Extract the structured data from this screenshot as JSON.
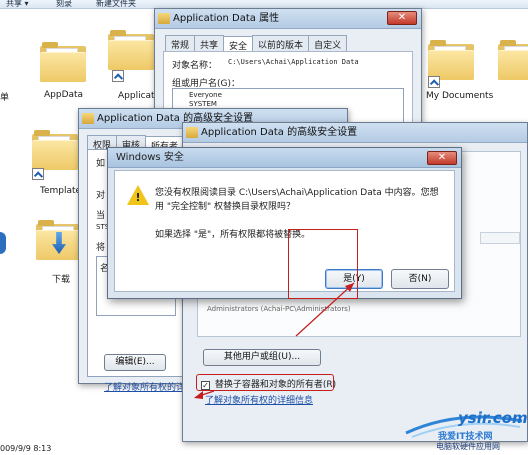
{
  "toolbar": {
    "items": [
      "共享 ▾",
      "刻录",
      "新建文件夹"
    ]
  },
  "desktop": {
    "labels": {
      "left_cut": "单",
      "appdata": "AppData",
      "application_cut": "Applicatio",
      "application_cut2": "Data",
      "templates_cut": "Template",
      "downloads": "下载",
      "my_documents": "My Documents"
    },
    "timestamp_cut": "009/9/9 8:13"
  },
  "props_window": {
    "title": "Application Data 属性",
    "tabs": [
      "常规",
      "共享",
      "安全",
      "以前的版本",
      "自定义"
    ],
    "active_tab": "安全",
    "object_name_label": "对象名称：",
    "object_name_value": "C:\\Users\\Achai\\Application Data",
    "group_label": "组或用户名(G)：",
    "users": [
      "Everyone",
      "SYSTEM"
    ]
  },
  "adv_window_back": {
    "title": "Application Data 的高级安全设置",
    "tabs": [
      "权限",
      "审核",
      "所有者"
    ],
    "frag": [
      "如",
      "对",
      "当",
      "STS",
      "将",
      "名"
    ]
  },
  "adv_window_front": {
    "title": "Application Data 的高级安全设置",
    "list_fragment": "Administrators (Achai-PC\\Administrators)",
    "other_users_button": "其他用户或组(U)...",
    "replace_owner_checkbox": "替换子容器和对象的所有者(R)",
    "learn_more_link": "了解对象所有权的详细信息",
    "edit_button": "编辑(E)...",
    "learn_more_link_back": "了解对象所有权的详细"
  },
  "alert": {
    "title": "Windows 安全",
    "message_line1": "您没有权限阅读目录 C:\\Users\\Achai\\Application Data 中内容。您想",
    "message_line2": "用 \"完全控制\" 权替换目录权限吗？",
    "message_line3": "如果选择 \"是\"，所有权限都将被替换。",
    "yes_button": "是(Y)",
    "no_button": "否(N)"
  },
  "watermark": {
    "logo_text": "ysir.com",
    "chinese": "我爱IT技术网",
    "subtitle": "电脑软硬件应用网"
  },
  "colors": {
    "highlight_red": "#c41e1e",
    "folder_yellow": "#eec966",
    "title_blue": "#b4cbe4"
  }
}
